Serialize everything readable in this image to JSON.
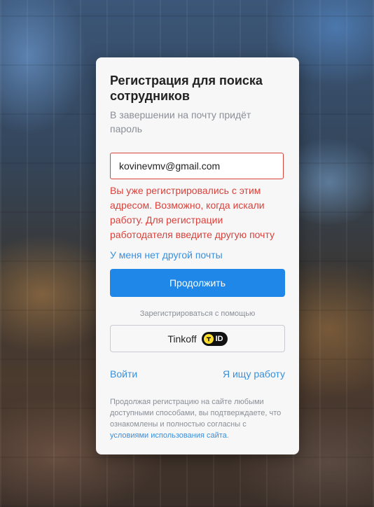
{
  "form": {
    "title": "Регистрация для поиска сотрудников",
    "subtitle": "В завершении на почту придёт пароль",
    "email_value": "kovinevmv@gmail.com",
    "error_text": "Вы уже регистрировались с этим адресом. Возможно, когда искали работу. Для регистрации работодателя введите другую почту",
    "no_other_email_link": "У меня нет другой почты",
    "continue_label": "Продолжить",
    "register_with_label": "Зарегистрироваться с помощью",
    "tinkoff_label": "Tinkoff",
    "tinkoff_id_badge": "ID",
    "login_link": "Войти",
    "job_seeker_link": "Я ищу работу",
    "terms_prefix": "Продолжая регистрацию на сайте любыми доступными способами, вы подтверждаете, что ознакомлены и полностью согласны с ",
    "terms_link": "условиями использования сайта",
    "terms_suffix": "."
  },
  "colors": {
    "accent": "#1f87e8",
    "link": "#3a8fdb",
    "error": "#d9423b",
    "card_bg": "#f7f7f8"
  },
  "icons": {
    "tinkoff_id": "tinkoff-id-icon"
  }
}
